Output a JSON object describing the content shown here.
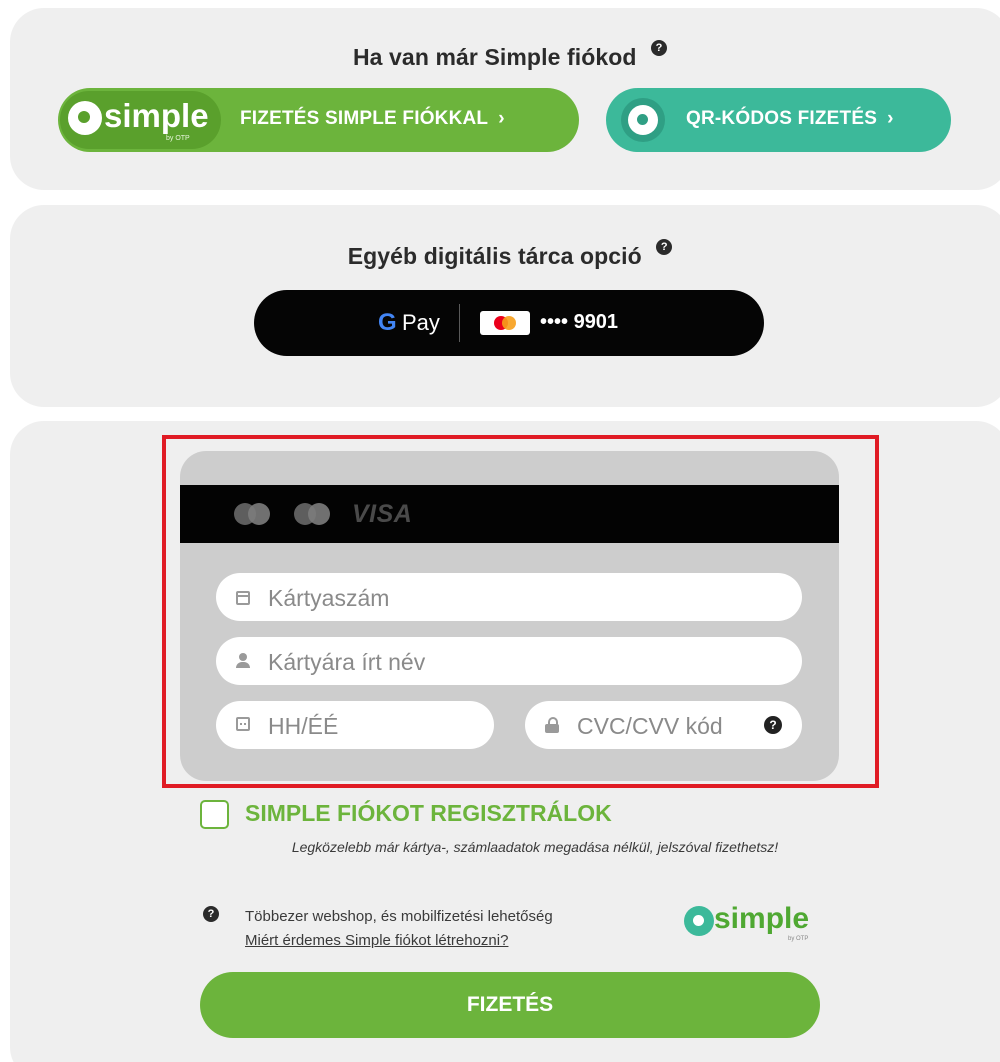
{
  "simple_section": {
    "heading": "Ha van már Simple fiókod",
    "help": "?",
    "logo_text": "simple",
    "logo_sub": "by OTP",
    "account_button_label": "FIZETÉS SIMPLE FIÓKKAL",
    "chevron": "›",
    "qr_button_label": "QR-KÓDOS FIZETÉS"
  },
  "wallet_section": {
    "heading": "Egyéb digitális tárca opció",
    "help": "?",
    "gpay_g": "G",
    "gpay_pay": "Pay",
    "card_number": "•••• 9901"
  },
  "card_form": {
    "brand_visa": "VISA",
    "card_number_placeholder": "Kártyaszám",
    "card_name_placeholder": "Kártyára írt név",
    "expiry_placeholder": "HH/ÉÉ",
    "cvc_placeholder": "CVC/CVV kód",
    "cvc_help": "?"
  },
  "registration": {
    "checkbox_label": "SIMPLE FIÓKOT REGISZTRÁLOK",
    "description": "Legközelebb már kártya-, számlaadatok megadása nélkül, jelszóval fizethetsz!",
    "info_help": "?",
    "info_text": "Többezer webshop, és mobilfizetési lehetőség",
    "info_link": "Miért érdemes Simple fiókot létrehozni?",
    "logo_text": "simple",
    "logo_sub": "by OTP"
  },
  "pay_button": {
    "label": "FIZETÉS"
  },
  "colors": {
    "simple_green": "#6cb43c",
    "qr_teal": "#3cb99a",
    "highlight_red": "#e01b24",
    "panel_gray": "#efefef"
  },
  "icons": [
    "help-icon",
    "simple-logo-icon",
    "qr-icon",
    "chevron-right-icon",
    "google-g-icon",
    "mastercard-icon",
    "visa-icon",
    "card-icon",
    "user-icon",
    "calendar-icon",
    "lock-icon"
  ]
}
